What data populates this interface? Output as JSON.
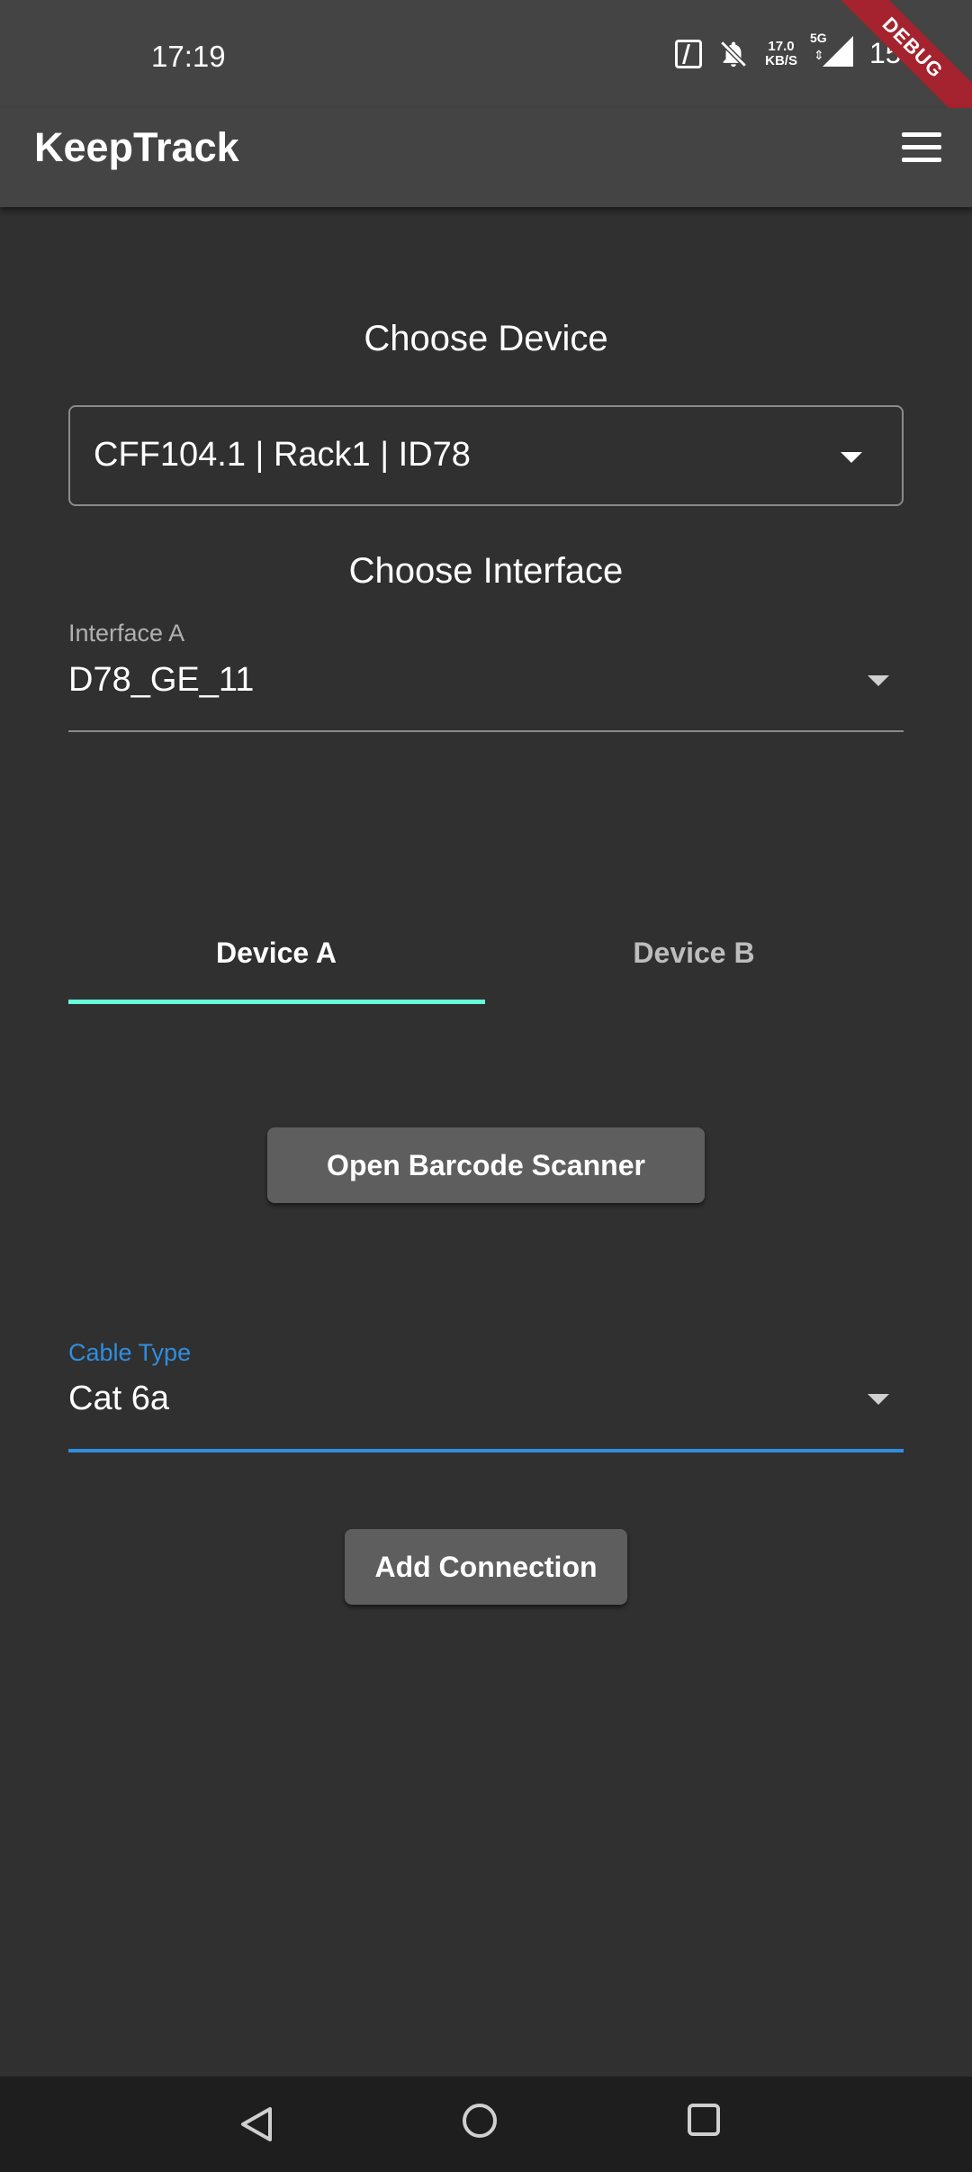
{
  "status_bar": {
    "time": "17:19",
    "network_speed_value": "17.0",
    "network_speed_unit": "KB/S",
    "network_type": "5G",
    "battery": "15%"
  },
  "debug_banner": "DEBUG",
  "app_bar": {
    "title": "KeepTrack"
  },
  "device_section": {
    "title": "Choose Device",
    "selected_device": "CFF104.1 | Rack1 | ID78"
  },
  "interface_section": {
    "title": "Choose Interface",
    "label": "Interface A",
    "value": "D78_GE_11"
  },
  "tabs": [
    {
      "label": "Device A",
      "selected": true
    },
    {
      "label": "Device B",
      "selected": false
    }
  ],
  "scanner_button": "Open Barcode Scanner",
  "cable_type": {
    "label": "Cable Type",
    "value": "Cat 6a"
  },
  "add_button": "Add Connection",
  "colors": {
    "background": "#303030",
    "appbar": "#444444",
    "tab_indicator": "#64ffda",
    "focus_accent": "#2f8ee0",
    "button": "#5e5e5e",
    "debug_banner": "#a4232e"
  },
  "icons": [
    "nfc-icon",
    "mute-bell-icon",
    "signal-icon",
    "menu-icon",
    "dropdown-caret-icon",
    "back-icon",
    "home-icon",
    "recents-icon"
  ]
}
